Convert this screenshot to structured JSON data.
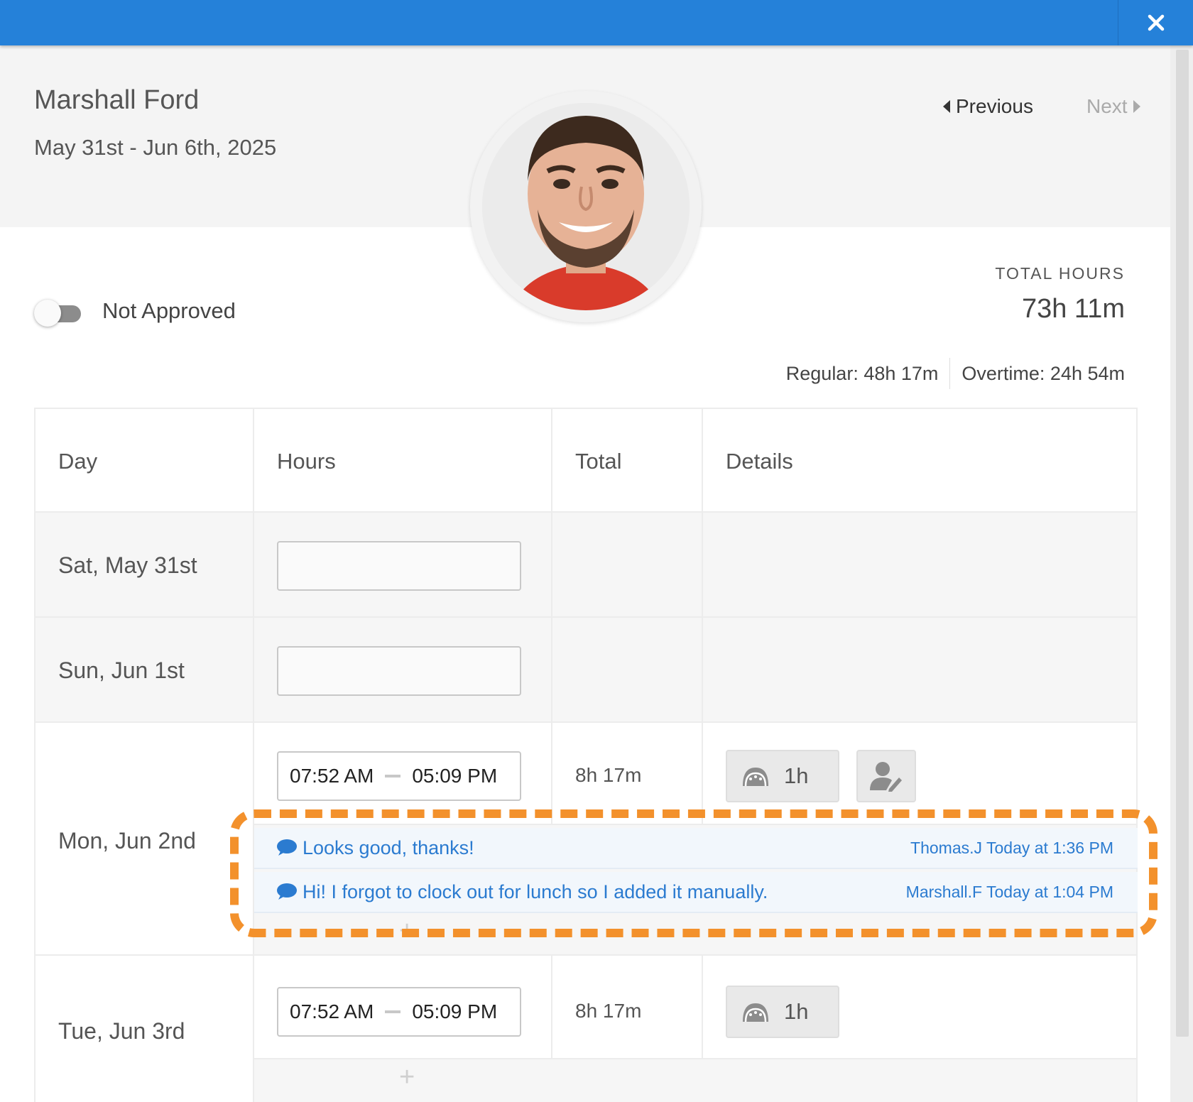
{
  "window": {
    "close_icon": "close-icon"
  },
  "employee": {
    "name": "Marshall Ford",
    "date_range": "May 31st - Jun 6th, 2025"
  },
  "navigation": {
    "previous": "Previous",
    "next": "Next"
  },
  "approval": {
    "status": "Not Approved",
    "approved": false
  },
  "totals": {
    "label": "TOTAL HOURS",
    "value": "73h 11m",
    "regular": "Regular: 48h 17m",
    "overtime": "Overtime: 24h 54m"
  },
  "table": {
    "headers": {
      "day": "Day",
      "hours": "Hours",
      "total": "Total",
      "details": "Details"
    },
    "rows": [
      {
        "day": "Sat, May 31st"
      },
      {
        "day": "Sun, Jun 1st"
      },
      {
        "day": "Mon, Jun 2nd",
        "start": "07:52 AM",
        "end": "05:09 PM",
        "total": "8h 17m",
        "break": "1h"
      },
      {
        "day": "Tue, Jun 3rd",
        "start": "07:52 AM",
        "end": "05:09 PM",
        "total": "8h 17m",
        "break": "1h"
      }
    ],
    "notes": [
      {
        "text": "Looks good, thanks!",
        "meta": "Thomas.J Today at 1:36 PM"
      },
      {
        "text": "Hi! I forgot to clock out for lunch so I added it manually.",
        "meta": "Marshall.F Today at 1:04 PM"
      }
    ],
    "add_label": "+"
  },
  "colors": {
    "topbar": "#2581d9",
    "note_text": "#2b7bd0",
    "highlight": "#f3912c"
  }
}
